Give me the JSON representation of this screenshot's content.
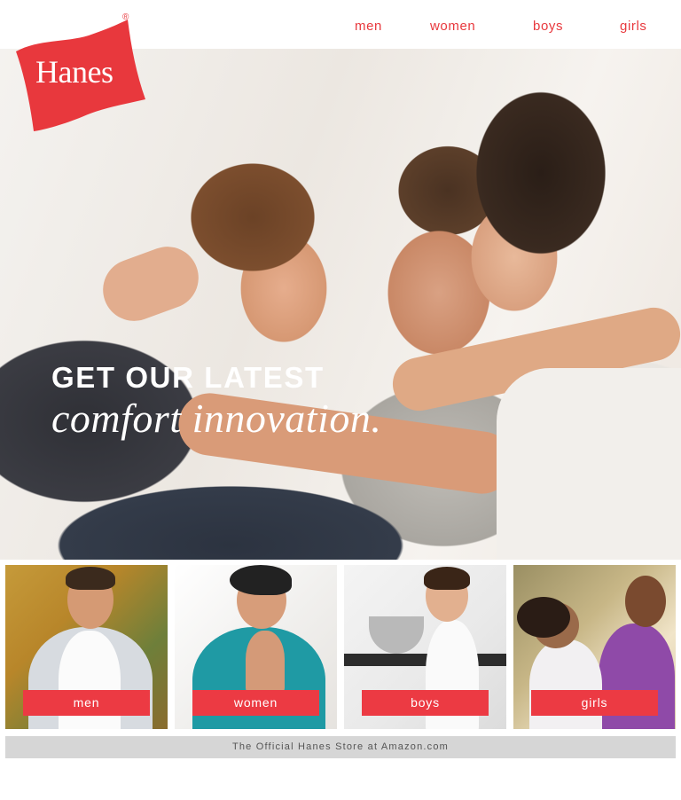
{
  "brand": {
    "logo_text": "Hanes",
    "registered_mark": "®",
    "accent_color": "#e8383d"
  },
  "nav": {
    "men": "men",
    "women": "women",
    "boys": "boys",
    "girls": "girls"
  },
  "hero": {
    "headline": "GET OUR LATEST",
    "subheadline": "comfort innovation."
  },
  "tiles": [
    {
      "label": "men"
    },
    {
      "label": "women"
    },
    {
      "label": "boys"
    },
    {
      "label": "girls"
    }
  ],
  "footer": {
    "text": "The Official Hanes Store at Amazon.com"
  }
}
